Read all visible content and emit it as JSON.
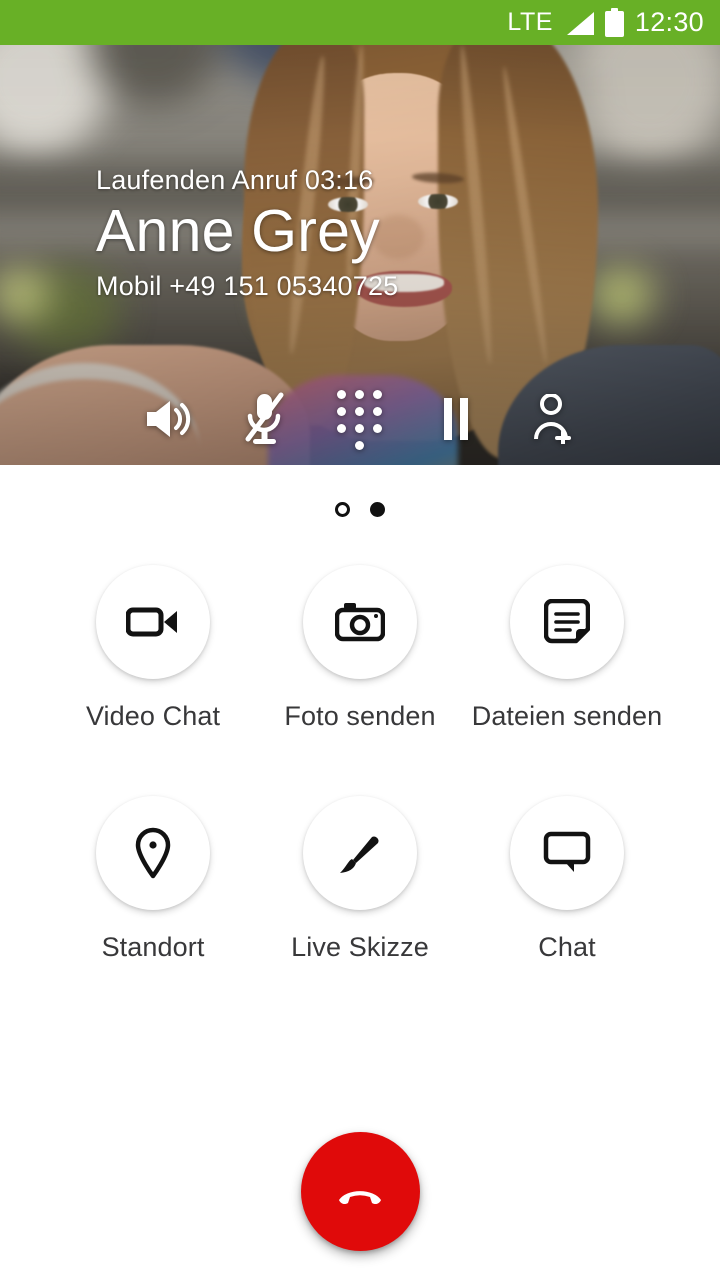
{
  "status_bar": {
    "network": "LTE",
    "time": "12:30",
    "signal_icon": "signal-bars-icon",
    "battery_icon": "battery-full-icon",
    "background_color": "#68b026"
  },
  "call": {
    "status_label": "Laufenden Anruf 03:16",
    "status_text": "Laufenden Anruf",
    "duration": "03:16",
    "contact_name": "Anne Grey",
    "phone_line": "Mobil +49 151 05340725",
    "phone_type": "Mobil",
    "phone_number": "+49 151 05340725",
    "controls": [
      {
        "name": "speaker-icon",
        "label": "Lautsprecher",
        "state": "on"
      },
      {
        "name": "microphone-muted-icon",
        "label": "Stumm",
        "state": "muted"
      },
      {
        "name": "dialpad-icon",
        "label": "Tastenfeld",
        "state": "off"
      },
      {
        "name": "pause-icon",
        "label": "Halten",
        "state": "off"
      },
      {
        "name": "add-person-icon",
        "label": "Teilnehmer hinzufügen",
        "state": "off"
      }
    ]
  },
  "pager": {
    "total_pages": 2,
    "current_page": 2,
    "dots": [
      {
        "state": "inactive"
      },
      {
        "state": "active"
      }
    ]
  },
  "actions": {
    "rows": [
      [
        {
          "icon": "video-camera-icon",
          "label": "Video Chat"
        },
        {
          "icon": "photo-camera-icon",
          "label": "Foto senden"
        },
        {
          "icon": "document-icon",
          "label": "Dateien senden"
        }
      ],
      [
        {
          "icon": "location-pin-icon",
          "label": "Standort"
        },
        {
          "icon": "paintbrush-icon",
          "label": "Live Skizze"
        },
        {
          "icon": "chat-bubble-icon",
          "label": "Chat"
        }
      ]
    ]
  },
  "end_call": {
    "icon": "end-call-handset-icon",
    "label": "Anruf beenden",
    "color": "#e00a0a"
  }
}
